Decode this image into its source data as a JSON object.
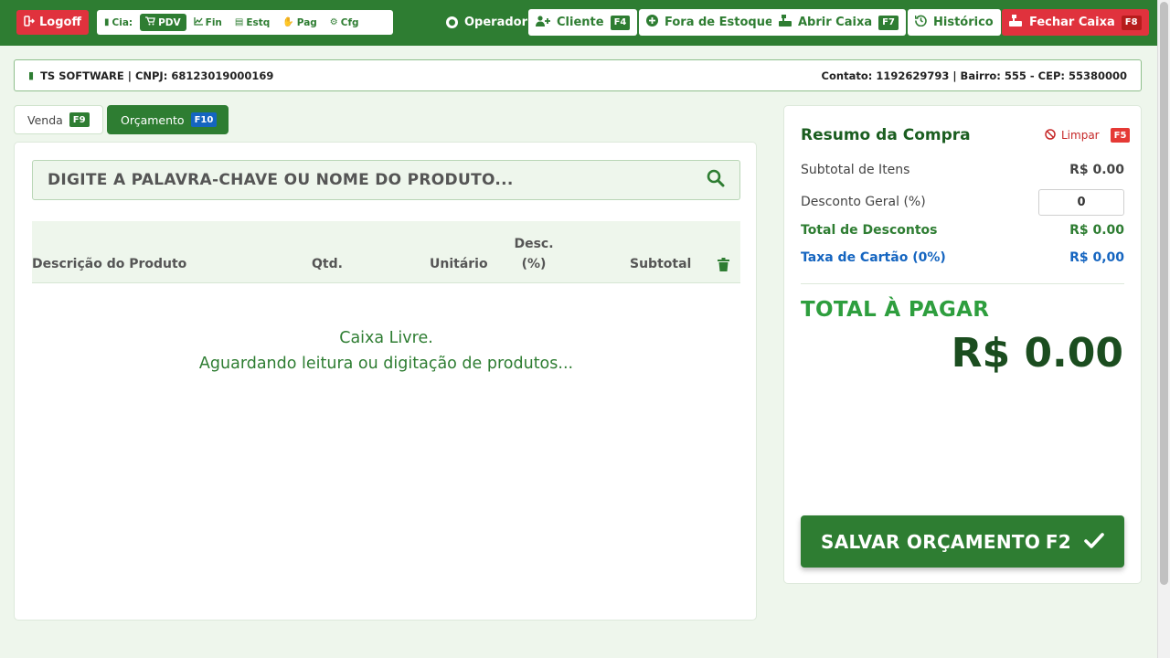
{
  "topbar": {
    "logoff_label": "Logoff",
    "modules": {
      "cia": "Cia:",
      "pdv": "PDV",
      "fin": "Fin",
      "estq": "Estq",
      "pag": "Pag",
      "cfg": "Cfg"
    },
    "operator_label": "Operador",
    "cliente_label": "Cliente",
    "cliente_key": "F4",
    "fora_estoque_label": "Fora de Estoque",
    "abrir_caixa_label": "Abrir Caixa",
    "abrir_caixa_key": "F7",
    "historico_label": "Histórico",
    "fechar_caixa_label": "Fechar Caixa",
    "fechar_caixa_key": "F8"
  },
  "company": {
    "name_cnpj": "TS SOFTWARE | CNPJ: 68123019000169",
    "contact": "Contato: 1192629793 | Bairro: 555 - CEP: 55380000"
  },
  "tabs": {
    "venda_label": "Venda",
    "venda_key": "F9",
    "orcamento_label": "Orçamento",
    "orcamento_key": "F10"
  },
  "search": {
    "placeholder": "DIGITE A PALAVRA-CHAVE OU NOME DO PRODUTO..."
  },
  "table": {
    "col_desc": "Descrição do Produto",
    "col_qtd": "Qtd.",
    "col_unit": "Unitário",
    "col_disc_1": "Desc.",
    "col_disc_2": "(%)",
    "col_subtotal": "Subtotal"
  },
  "empty": {
    "line1": "Caixa Livre.",
    "line2": "Aguardando leitura ou digitação de produtos..."
  },
  "summary": {
    "title": "Resumo da Compra",
    "limpar_label": "Limpar",
    "limpar_key": "F5",
    "subtotal_label": "Subtotal de Itens",
    "subtotal_value": "R$ 0.00",
    "discount_label": "Desconto Geral (%)",
    "discount_value": "0",
    "total_disc_label": "Total de Descontos",
    "total_disc_value": "R$ 0.00",
    "card_fee_label": "Taxa de Cartão (0%)",
    "card_fee_value": "R$ 0,00",
    "total_label": "TOTAL À PAGAR",
    "total_value": "R$ 0.00",
    "save_label": "SALVAR ORÇAMENTO",
    "save_key": "F2"
  },
  "colors": {
    "primary_green": "#2e7d32",
    "danger_red": "#e0323d",
    "info_blue": "#1565c0",
    "background": "#eef6ec"
  }
}
